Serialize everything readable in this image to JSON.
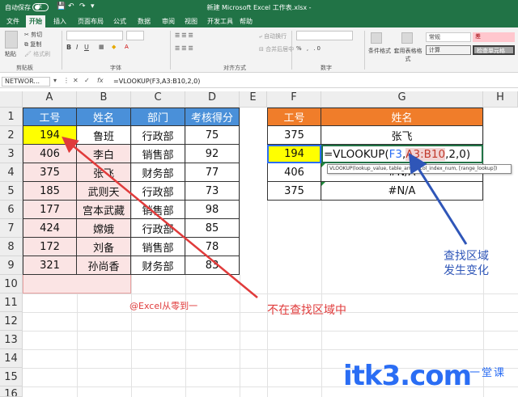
{
  "titlebar": {
    "autosave": "自动保存",
    "autosave_state": "关",
    "title": "新建 Microsoft Excel 工作表.xlsx -"
  },
  "tabs": [
    "文件",
    "开始",
    "插入",
    "页面布局",
    "公式",
    "数据",
    "审阅",
    "视图",
    "开发工具",
    "帮助"
  ],
  "ribbon": {
    "cut": "剪切",
    "copy": "复制",
    "format_painter": "格式刷",
    "paste": "粘贴",
    "group_clipboard": "剪贴板",
    "group_font": "字体",
    "wrap": "自动换行",
    "merge": "合并后居中",
    "group_align": "对齐方式",
    "group_number": "数字",
    "cond_format": "条件格式",
    "table_format": "套用表格格式",
    "style_normal": "常规",
    "style_bad": "差",
    "style_calc": "计算",
    "style_check": "检查单元格"
  },
  "formula_bar": {
    "namebox": "NETWOR...",
    "formula": "=VLOOKUP(F3,A3:B10,2,0)"
  },
  "columns": [
    "A",
    "B",
    "C",
    "D",
    "E",
    "F",
    "G",
    "H"
  ],
  "rows": [
    "1",
    "2",
    "3",
    "4",
    "5",
    "6",
    "7",
    "8",
    "9",
    "10",
    "11",
    "12",
    "13",
    "14",
    "15",
    "16"
  ],
  "table_left": {
    "headers": [
      "工号",
      "姓名",
      "部门",
      "考核得分"
    ],
    "rows": [
      [
        "194",
        "鲁班",
        "行政部",
        "75"
      ],
      [
        "406",
        "李白",
        "销售部",
        "92"
      ],
      [
        "375",
        "张飞",
        "财务部",
        "77"
      ],
      [
        "185",
        "武则天",
        "行政部",
        "73"
      ],
      [
        "177",
        "宫本武藏",
        "销售部",
        "98"
      ],
      [
        "424",
        "嫦娥",
        "行政部",
        "85"
      ],
      [
        "172",
        "刘备",
        "销售部",
        "78"
      ],
      [
        "321",
        "孙尚香",
        "财务部",
        "83"
      ]
    ]
  },
  "table_right": {
    "headers": [
      "工号",
      "姓名"
    ],
    "rows": [
      [
        "375",
        "张飞"
      ],
      [
        "194",
        "=VLOOKUP(F3,A3:B10,2,0)"
      ],
      [
        "406",
        "#N/A"
      ],
      [
        "375",
        "#N/A"
      ]
    ]
  },
  "formula_parts": {
    "prefix": "=VLOOKUP(",
    "ref1": "F3",
    "sep1": ",",
    "ref2": "A3:B10",
    "suffix": ",2,0)"
  },
  "tooltip": "VLOOKUP(lookup_value, table_array, col_index_num, [range_lookup])",
  "annotations": {
    "range_change": [
      "查找区域",
      "发生变化"
    ],
    "not_in_range": "不在查找区域中",
    "credit": "@Excel从零到一",
    "watermark": "itk3.com",
    "watermark_cn": "一堂课"
  },
  "colors": {
    "excel_green": "#217346",
    "header_blue": "#4a90d9",
    "header_orange": "#f07d2a",
    "highlight_yellow": "#ffff00",
    "pink_range": "#fbe4e4",
    "arrow_red": "#e03b3b",
    "arrow_blue": "#2f56b8"
  }
}
